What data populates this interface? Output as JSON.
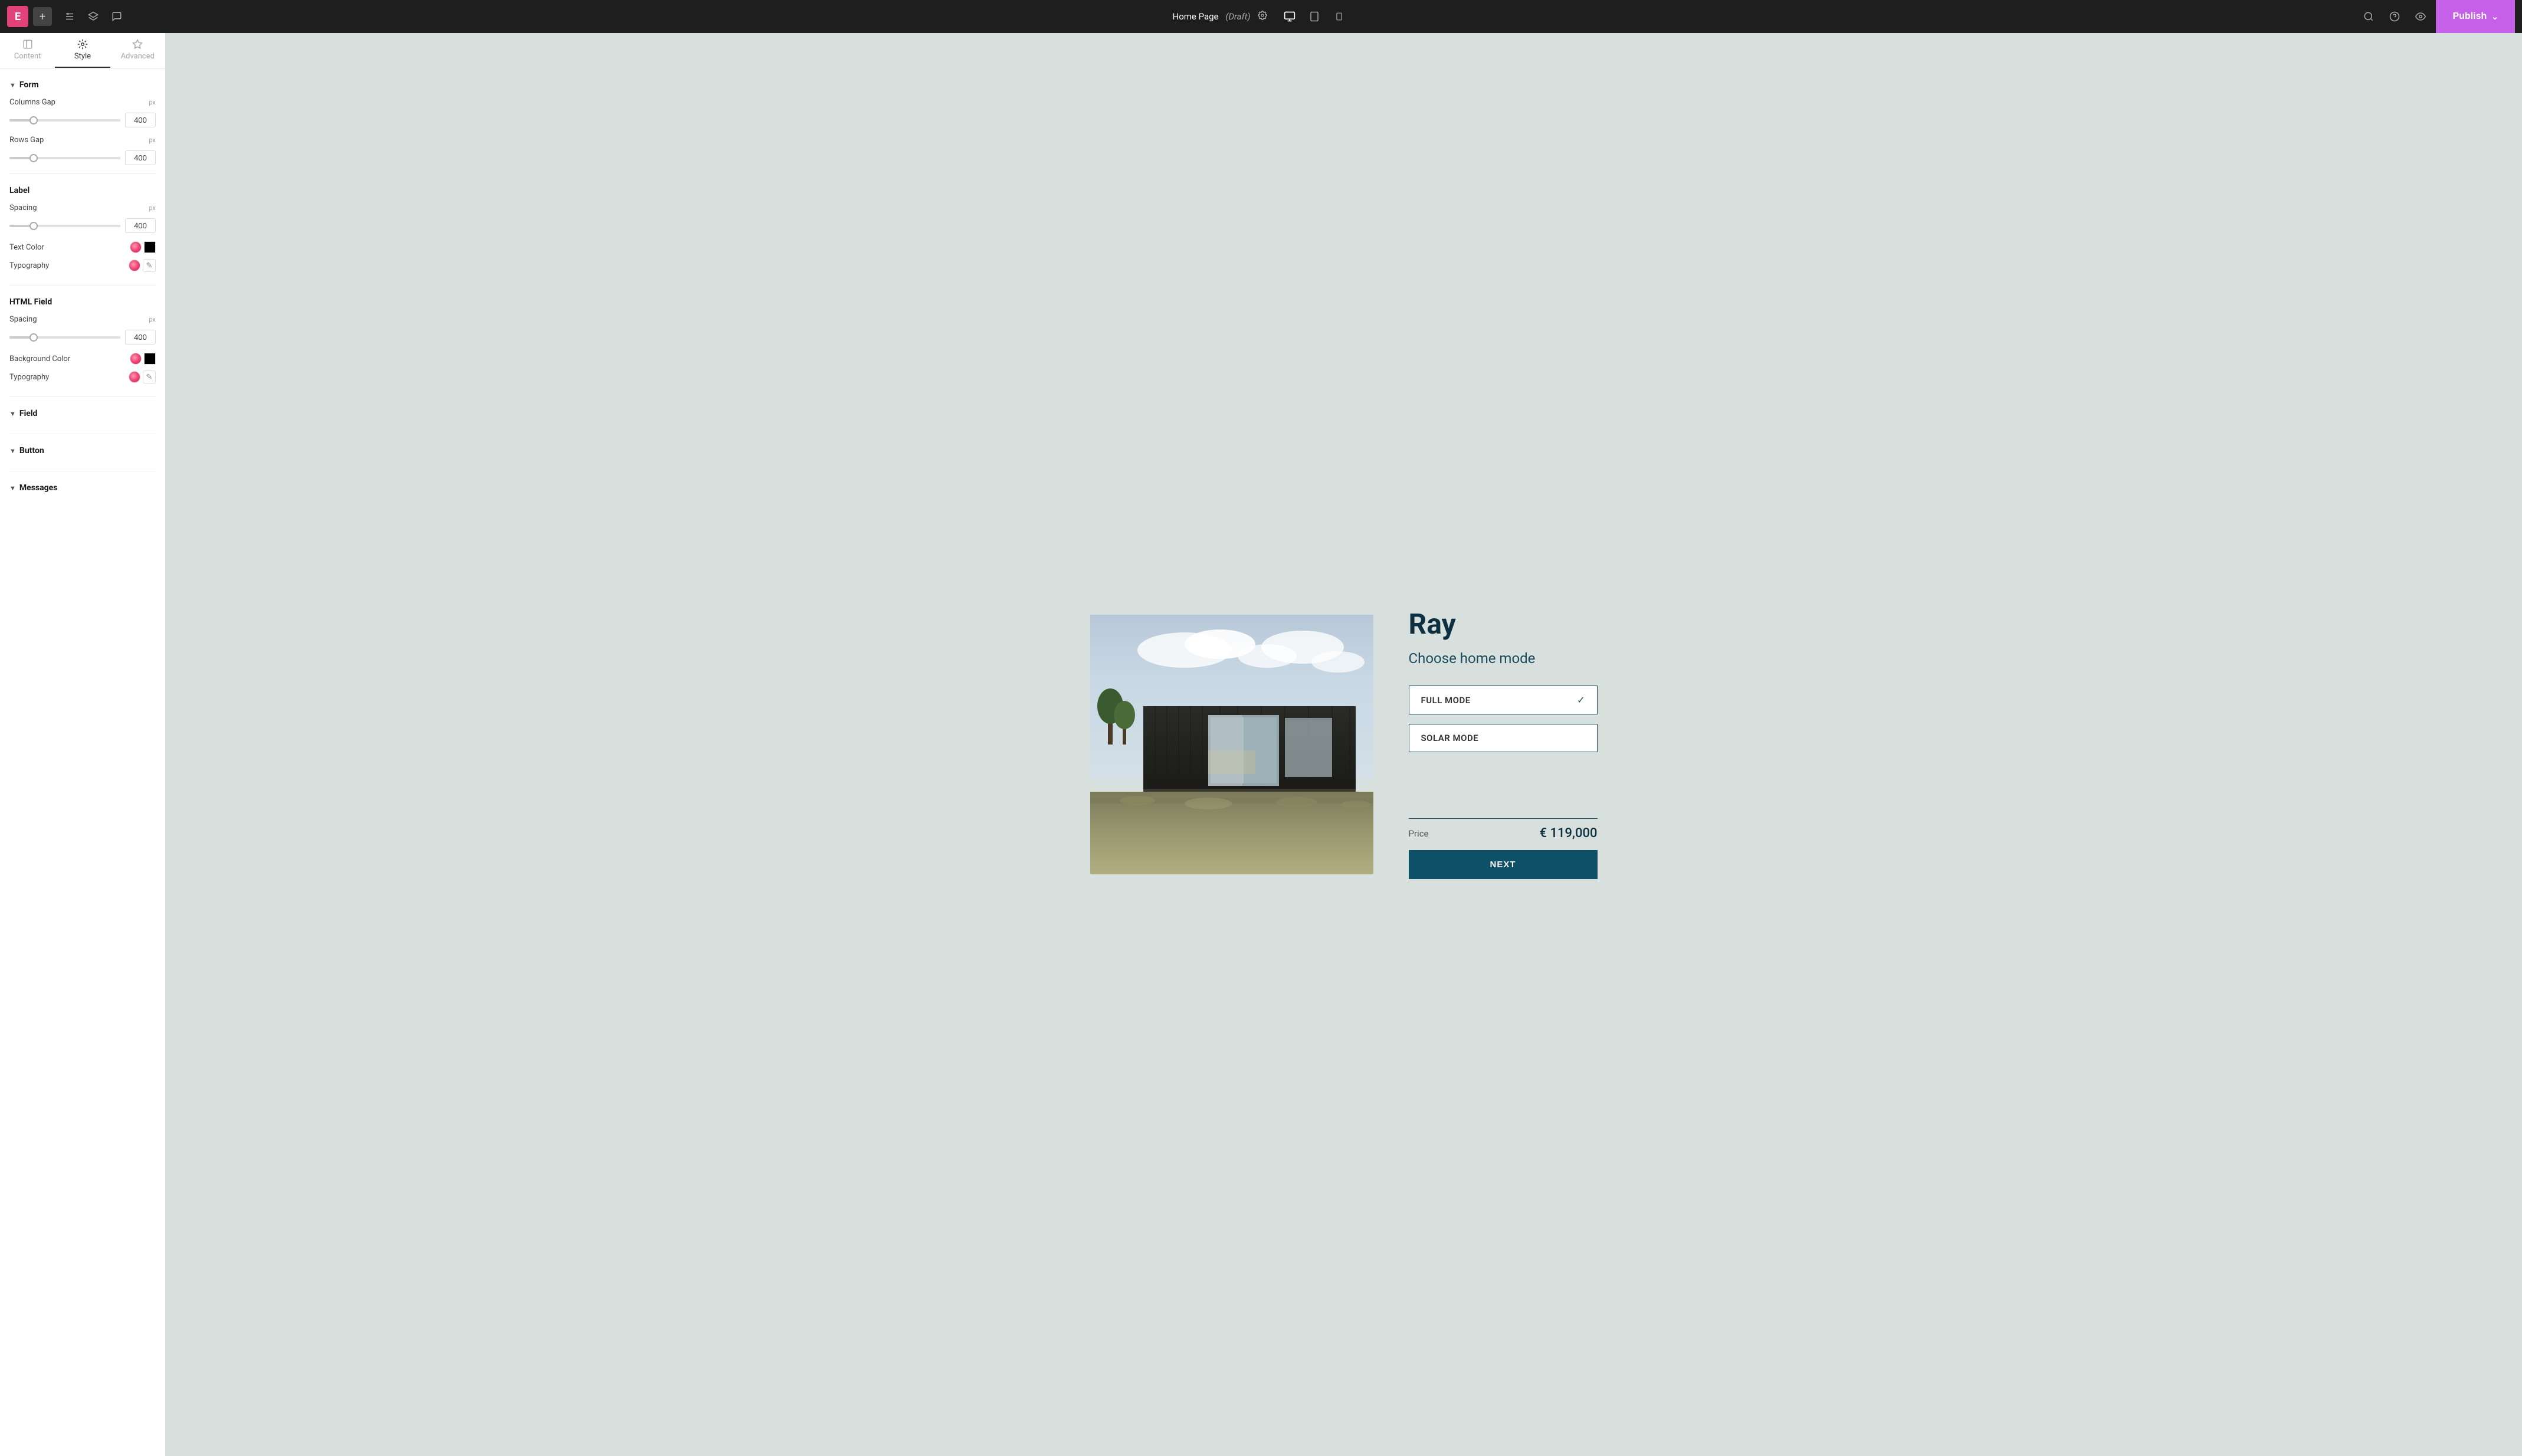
{
  "topbar": {
    "logo": "E",
    "add_label": "+",
    "page_title": "Home Page",
    "page_draft": "(Draft)",
    "publish_label": "Publish",
    "view_icons": [
      "desktop",
      "tablet",
      "mobile"
    ]
  },
  "sidebar": {
    "tabs": [
      {
        "id": "content",
        "label": "Content"
      },
      {
        "id": "style",
        "label": "Style",
        "active": true
      },
      {
        "id": "advanced",
        "label": "Advanced"
      }
    ],
    "form_section": {
      "title": "Form",
      "columns_gap": {
        "label": "Columns Gap",
        "unit": "px",
        "value": "400",
        "slider_pct": 22
      },
      "rows_gap": {
        "label": "Rows Gap",
        "unit": "px",
        "value": "400",
        "slider_pct": 22
      }
    },
    "label_section": {
      "title": "Label",
      "spacing": {
        "label": "Spacing",
        "unit": "px",
        "value": "400",
        "slider_pct": 22
      },
      "text_color": {
        "label": "Text Color"
      },
      "typography": {
        "label": "Typography"
      }
    },
    "html_field_section": {
      "title": "HTML Field",
      "spacing": {
        "label": "Spacing",
        "unit": "px",
        "value": "400",
        "slider_pct": 22
      },
      "background_color": {
        "label": "Background Color"
      },
      "typography": {
        "label": "Typography"
      }
    },
    "field_section": {
      "title": "Field"
    },
    "button_section": {
      "title": "Button"
    },
    "messages_section": {
      "title": "Messages"
    }
  },
  "main": {
    "product": {
      "title": "Ray",
      "subtitle": "Choose home mode",
      "modes": [
        {
          "id": "full",
          "label": "FULL MODE",
          "selected": true
        },
        {
          "id": "solar",
          "label": "SOLAR MODE",
          "selected": false
        }
      ],
      "price_label": "Price",
      "price_value": "€ 119,000",
      "next_label": "NEXT"
    }
  }
}
